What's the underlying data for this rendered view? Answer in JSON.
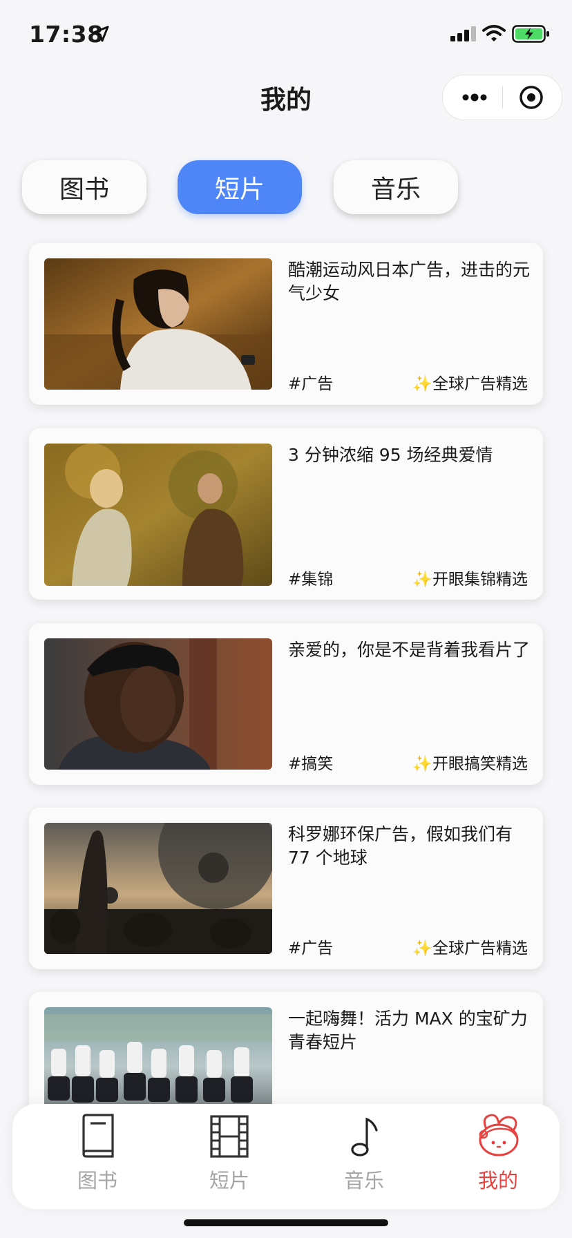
{
  "status": {
    "time": "17:38"
  },
  "header": {
    "title": "我的"
  },
  "tabs": [
    {
      "label": "图书",
      "active": false
    },
    {
      "label": "短片",
      "active": true
    },
    {
      "label": "音乐",
      "active": false
    }
  ],
  "cards": [
    {
      "title": "酷潮运动风日本广告，进击的元气少女",
      "tag": "#广告",
      "source": "✨全球广告精选"
    },
    {
      "title": "3 分钟浓缩 95 场经典爱情",
      "tag": "#集锦",
      "source": "✨开眼集锦精选"
    },
    {
      "title": "亲爱的，你是不是背着我看片了",
      "tag": "#搞笑",
      "source": "✨开眼搞笑精选"
    },
    {
      "title": "科罗娜环保广告，假如我们有 77 个地球",
      "tag": "#广告",
      "source": "✨全球广告精选"
    },
    {
      "title": "一起嗨舞！活力 MAX 的宝矿力青春短片",
      "tag": "",
      "source": ""
    }
  ],
  "tabbar": [
    {
      "label": "图书",
      "icon": "book-icon"
    },
    {
      "label": "短片",
      "icon": "film-icon"
    },
    {
      "label": "音乐",
      "icon": "music-note-icon"
    },
    {
      "label": "我的",
      "icon": "character-avatar-icon",
      "active": true
    }
  ],
  "colors": {
    "accent": "#4f86f7",
    "active_tab": "#e64340",
    "inactive_tab": "#a5a5a5",
    "battery": "#4cd964"
  }
}
